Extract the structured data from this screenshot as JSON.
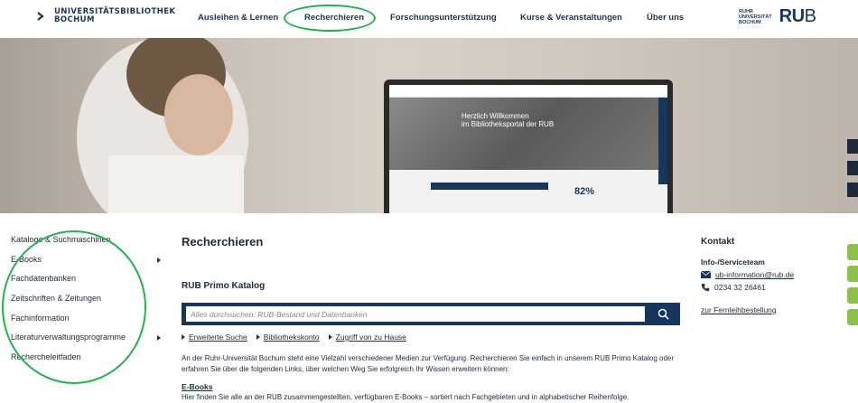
{
  "header": {
    "logo_line1": "UNIVERSITÄTSBIBLIOTHEK",
    "logo_line2": "BOCHUM",
    "nav": [
      {
        "label": "Ausleihen & Lernen"
      },
      {
        "label": "Recherchieren"
      },
      {
        "label": "Forschungsunterstützung"
      },
      {
        "label": "Kurse & Veranstaltungen"
      },
      {
        "label": "Über uns"
      }
    ],
    "rub_small_1": "RUHR",
    "rub_small_2": "UNIVERSITÄT",
    "rub_small_3": "BOCHUM",
    "rub_big": "RU",
    "rub_big_end": "B"
  },
  "hero": {
    "screen_title_1": "Herzlich Willkommen",
    "screen_title_2": "im Bibliotheksportal der RUB",
    "screen_pct": "82%"
  },
  "sidebar": {
    "items": [
      {
        "label": "Kataloge & Suchmaschinen"
      },
      {
        "label": "E-Books"
      },
      {
        "label": "Fachdatenbanken"
      },
      {
        "label": "Zeitschriften & Zeitungen"
      },
      {
        "label": "Fachinformation"
      },
      {
        "label": "Literaturverwaltungsprogramme"
      },
      {
        "label": "Rechercheleitfaden"
      }
    ]
  },
  "main": {
    "title": "Recherchieren",
    "catalog_title": "RUB Primo Katalog",
    "search_placeholder": "Alles durchsuchen: RUB-Bestand und Datenbanken",
    "links": [
      {
        "label": "Erweiterte Suche"
      },
      {
        "label": "Bibliothekskonto"
      },
      {
        "label": "Zugriff von zu Hause"
      }
    ],
    "intro": "An der Ruhr-Universität Bochum steht eine Vielzahl verschiedener Medien zur Verfügung. Recherchieren Sie einfach in unserem RUB Primo Katalog oder erfahren Sie über die folgenden Links, über welchen Weg Sie erfolgreich Ihr Wissen erweitern können:",
    "ebooks_heading": "E-Books",
    "ebooks_text": "Hier finden Sie alle an der RUB zusammengestellten, verfügbaren E-Books – sortiert nach Fachgebieten und in alphabetischer Reihenfolge."
  },
  "contact": {
    "title": "Kontakt",
    "team": "Info-/Serviceteam",
    "email": "ub-information@rub.de",
    "phone": "0234 32 26461",
    "loan_link": "zur Fernleihbestellung"
  },
  "colors": {
    "navy": "#17365d",
    "annotation_green": "#1fb34a",
    "social_green": "#8bc34a"
  }
}
